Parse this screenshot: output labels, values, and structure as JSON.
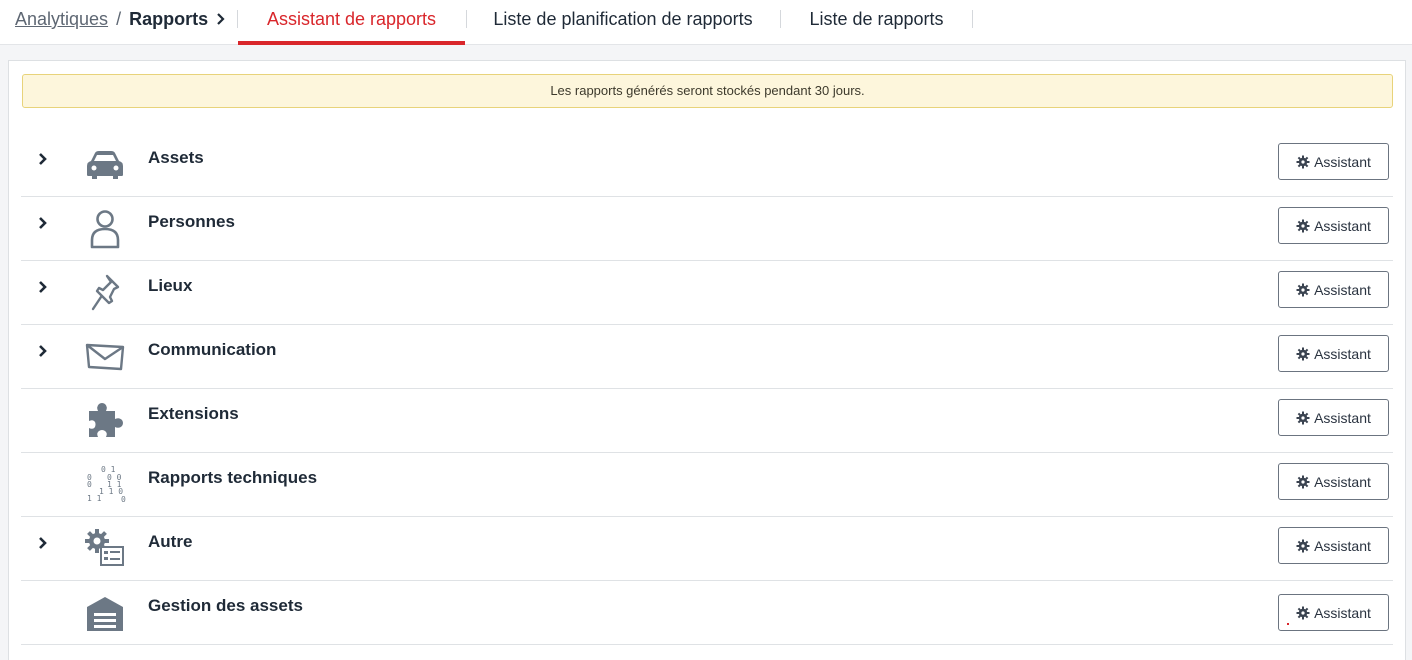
{
  "breadcrumb": {
    "parent": "Analytiques",
    "separator": "/",
    "current": "Rapports"
  },
  "tabs": [
    {
      "label": "Assistant de rapports",
      "active": true
    },
    {
      "label": "Liste de planification de rapports",
      "active": false
    },
    {
      "label": "Liste de rapports",
      "active": false
    }
  ],
  "notice": "Les rapports générés seront stockés pendant 30 jours.",
  "rows": [
    {
      "label": "Assets",
      "icon": "car-icon",
      "expandable": true,
      "button": "Assistant"
    },
    {
      "label": "Personnes",
      "icon": "person-icon",
      "expandable": true,
      "button": "Assistant"
    },
    {
      "label": "Lieux",
      "icon": "pushpin-icon",
      "expandable": true,
      "button": "Assistant"
    },
    {
      "label": "Communication",
      "icon": "envelope-icon",
      "expandable": true,
      "button": "Assistant"
    },
    {
      "label": "Extensions",
      "icon": "puzzle-icon",
      "expandable": false,
      "button": "Assistant"
    },
    {
      "label": "Rapports techniques",
      "icon": "binary-icon",
      "expandable": false,
      "button": "Assistant"
    },
    {
      "label": "Autre",
      "icon": "gear-form-icon",
      "expandable": true,
      "button": "Assistant"
    },
    {
      "label": "Gestion des assets",
      "icon": "warehouse-icon",
      "expandable": false,
      "button": "Assistant"
    }
  ],
  "colors": {
    "accent": "#d9262b",
    "icon": "#6c7885",
    "notice_bg": "#fdf6dc"
  }
}
